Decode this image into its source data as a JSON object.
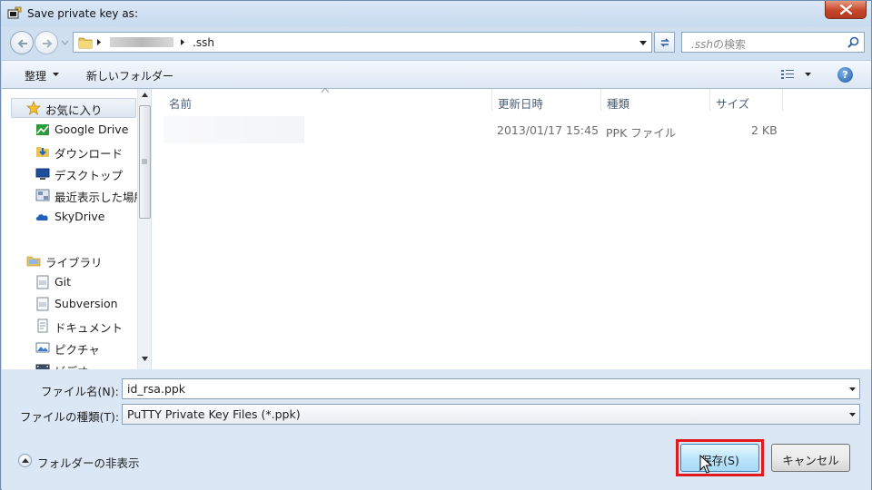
{
  "window": {
    "title": "Save private key as:"
  },
  "navbar": {
    "breadcrumb_current": ".ssh",
    "search_placeholder_prefix": ".ssh",
    "search_placeholder_suffix": "の検索"
  },
  "toolbar": {
    "organize_label": "整理",
    "new_folder_label": "新しいフォルダー",
    "help_label": "?"
  },
  "sidebar": {
    "favorites_label": "お気に入り",
    "favorites": [
      {
        "label": "Google Drive",
        "icon": "google-drive-icon"
      },
      {
        "label": "ダウンロード",
        "icon": "downloads-folder-icon"
      },
      {
        "label": "デスクトップ",
        "icon": "desktop-icon"
      },
      {
        "label": "最近表示した場所",
        "icon": "recent-places-icon"
      },
      {
        "label": "SkyDrive",
        "icon": "skydrive-icon"
      }
    ],
    "libraries_label": "ライブラリ",
    "libraries": [
      {
        "label": "Git",
        "icon": "git-library-icon"
      },
      {
        "label": "Subversion",
        "icon": "subversion-library-icon"
      },
      {
        "label": "ドキュメント",
        "icon": "documents-library-icon"
      },
      {
        "label": "ピクチャ",
        "icon": "pictures-library-icon"
      },
      {
        "label": "ビデオ",
        "icon": "videos-library-icon"
      }
    ]
  },
  "file_list": {
    "columns": [
      "名前",
      "更新日時",
      "種類",
      "サイズ"
    ],
    "rows": [
      {
        "name": "",
        "modified": "2013/01/17 15:45",
        "type": "PPK ファイル",
        "size": "2 KB"
      }
    ]
  },
  "bottom": {
    "filename_label": "ファイル名(N):",
    "filename_value": "id_rsa.ppk",
    "filetype_label": "ファイルの種類(T):",
    "filetype_value": "PuTTY Private Key Files (*.ppk)",
    "hide_folders_label": "フォルダーの非表示",
    "save_label": "保存(S)",
    "cancel_label": "キャンセル"
  },
  "colors": {
    "highlight_outline": "#e0191f",
    "window_frame": "#cfdff0"
  }
}
